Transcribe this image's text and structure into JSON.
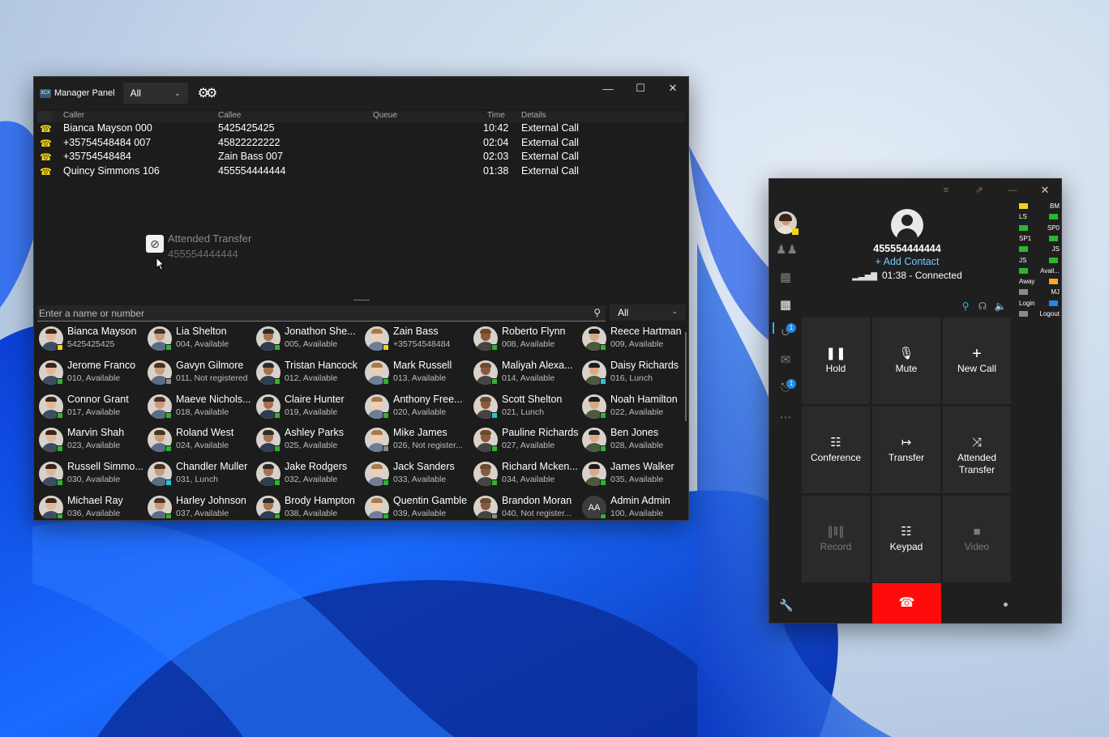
{
  "manager_panel": {
    "title": "Manager Panel",
    "logo_text": "3CX",
    "filter_value": "All",
    "window_controls": {
      "minimize": "—",
      "maximize": "☐",
      "close": "✕"
    },
    "columns": {
      "caller": "Caller",
      "callee": "Callee",
      "queue": "Queue",
      "time": "Time",
      "details": "Details"
    },
    "calls": [
      {
        "caller": "Bianca Mayson 000",
        "callee": "5425425425",
        "queue": "",
        "time": "10:42",
        "details": "External Call"
      },
      {
        "caller": "+35754548484 007",
        "callee": "45822222222",
        "queue": "",
        "time": "02:04",
        "details": "External Call"
      },
      {
        "caller": "+35754548484",
        "callee": "Zain Bass 007",
        "queue": "",
        "time": "02:03",
        "details": "External Call"
      },
      {
        "caller": "Quincy Simmons 106",
        "callee": "455554444444",
        "queue": "",
        "time": "01:38",
        "details": "External Call"
      }
    ],
    "drag_ghost": {
      "label": "Attended Transfer",
      "number": "455554444444"
    },
    "search_placeholder": "Enter a name or number",
    "contact_filter": "All",
    "contacts": [
      {
        "name": "Bianca Mayson",
        "sub": "5425425425",
        "status": "yellow"
      },
      {
        "name": "Lia Shelton",
        "sub": "004, Available",
        "status": "green"
      },
      {
        "name": "Jonathon She...",
        "sub": "005, Available",
        "status": "green"
      },
      {
        "name": "Zain Bass",
        "sub": "+35754548484",
        "status": "yellow"
      },
      {
        "name": "Roberto Flynn",
        "sub": "008, Available",
        "status": "green"
      },
      {
        "name": "Reece Hartman",
        "sub": "009, Available",
        "status": "green"
      },
      {
        "name": "Jerome Franco",
        "sub": "010, Available",
        "status": "green"
      },
      {
        "name": "Gavyn Gilmore",
        "sub": "011, Not registered",
        "status": "gray"
      },
      {
        "name": "Tristan Hancock",
        "sub": "012, Available",
        "status": "green"
      },
      {
        "name": "Mark Russell",
        "sub": "013, Available",
        "status": "green"
      },
      {
        "name": "Maliyah Alexa...",
        "sub": "014, Available",
        "status": "green"
      },
      {
        "name": "Daisy Richards",
        "sub": "016, Lunch",
        "status": "teal"
      },
      {
        "name": "Connor Grant",
        "sub": "017, Available",
        "status": "green"
      },
      {
        "name": "Maeve Nichols...",
        "sub": "018, Available",
        "status": "green"
      },
      {
        "name": "Claire Hunter",
        "sub": "019, Available",
        "status": "green"
      },
      {
        "name": "Anthony Free...",
        "sub": "020, Available",
        "status": "green"
      },
      {
        "name": "Scott Shelton",
        "sub": "021, Lunch",
        "status": "teal"
      },
      {
        "name": "Noah Hamilton",
        "sub": "022, Available",
        "status": "green"
      },
      {
        "name": "Marvin Shah",
        "sub": "023, Available",
        "status": "green"
      },
      {
        "name": "Roland West",
        "sub": "024, Available",
        "status": "green"
      },
      {
        "name": "Ashley Parks",
        "sub": "025, Available",
        "status": "green"
      },
      {
        "name": "Mike James",
        "sub": "026, Not register...",
        "status": "gray"
      },
      {
        "name": "Pauline Richards",
        "sub": "027, Available",
        "status": "green"
      },
      {
        "name": "Ben Jones",
        "sub": "028, Available",
        "status": "green"
      },
      {
        "name": "Russell Simmo...",
        "sub": "030, Available",
        "status": "green"
      },
      {
        "name": "Chandler Muller",
        "sub": "031, Lunch",
        "status": "teal"
      },
      {
        "name": "Jake Rodgers",
        "sub": "032, Available",
        "status": "green"
      },
      {
        "name": "Jack Sanders",
        "sub": "033, Available",
        "status": "green"
      },
      {
        "name": "Richard Mcken...",
        "sub": "034, Available",
        "status": "green"
      },
      {
        "name": "James Walker",
        "sub": "035, Available",
        "status": "green"
      },
      {
        "name": "Michael Ray",
        "sub": "036, Available",
        "status": "green"
      },
      {
        "name": "Harley Johnson",
        "sub": "037, Available",
        "status": "green"
      },
      {
        "name": "Brody Hampton",
        "sub": "038, Available",
        "status": "green"
      },
      {
        "name": "Quentin Gamble",
        "sub": "039, Available",
        "status": "green"
      },
      {
        "name": "Brandon Moran",
        "sub": "040, Not register...",
        "status": "gray"
      },
      {
        "name": "Admin Admin",
        "sub": "100, Available",
        "status": "green",
        "initials": "AA"
      }
    ]
  },
  "softphone": {
    "number": "455554444444",
    "add_contact": "+ Add Contact",
    "status": "01:38 - Connected",
    "side_badges": {
      "history": "1",
      "voicemail": "1"
    },
    "buttons": [
      {
        "id": "hold",
        "label": "Hold",
        "icon": "pause-icon",
        "disabled": false
      },
      {
        "id": "mute",
        "label": "Mute",
        "icon": "microphone-icon",
        "disabled": false
      },
      {
        "id": "new-call",
        "label": "New Call",
        "icon": "plus-icon",
        "disabled": false
      },
      {
        "id": "conference",
        "label": "Conference",
        "icon": "conference-icon",
        "disabled": false
      },
      {
        "id": "transfer",
        "label": "Transfer",
        "icon": "transfer-icon",
        "disabled": false
      },
      {
        "id": "attended-transfer",
        "label": "Attended Transfer",
        "icon": "attended-transfer-icon",
        "disabled": false
      },
      {
        "id": "record",
        "label": "Record",
        "icon": "record-icon",
        "disabled": true
      },
      {
        "id": "keypad",
        "label": "Keypad",
        "icon": "keypad-icon",
        "disabled": false
      },
      {
        "id": "video",
        "label": "Video",
        "icon": "video-icon",
        "disabled": true
      }
    ],
    "presence_list": [
      {
        "label": "BM",
        "color": "#f1d417",
        "side": "left"
      },
      {
        "label": "LS",
        "color": "#2db52d",
        "side": "right"
      },
      {
        "label": "SP0",
        "color": "#2db52d",
        "side": "left"
      },
      {
        "label": "SP1",
        "color": "#2db52d",
        "side": "right"
      },
      {
        "label": "JS",
        "color": "#2db52d",
        "side": "left"
      },
      {
        "label": "JS",
        "color": "#2db52d",
        "side": "right"
      },
      {
        "label": "Avail...",
        "color": "#2db52d",
        "side": "left"
      },
      {
        "label": "Away",
        "color": "#f5a623",
        "side": "right"
      },
      {
        "label": "MJ",
        "color": "#8a8a8a",
        "side": "left"
      },
      {
        "label": "Login",
        "color": "#1e88e5",
        "side": "right"
      },
      {
        "label": "Logout",
        "color": "#8a8a8a",
        "side": "left"
      }
    ],
    "colors": {
      "hangup": "#ff0b0b",
      "link": "#7cc7ff"
    }
  },
  "status_colors": {
    "green": "#2db52d",
    "yellow": "#f1d417",
    "gray": "#8a8a8a",
    "teal": "#26c6da"
  }
}
